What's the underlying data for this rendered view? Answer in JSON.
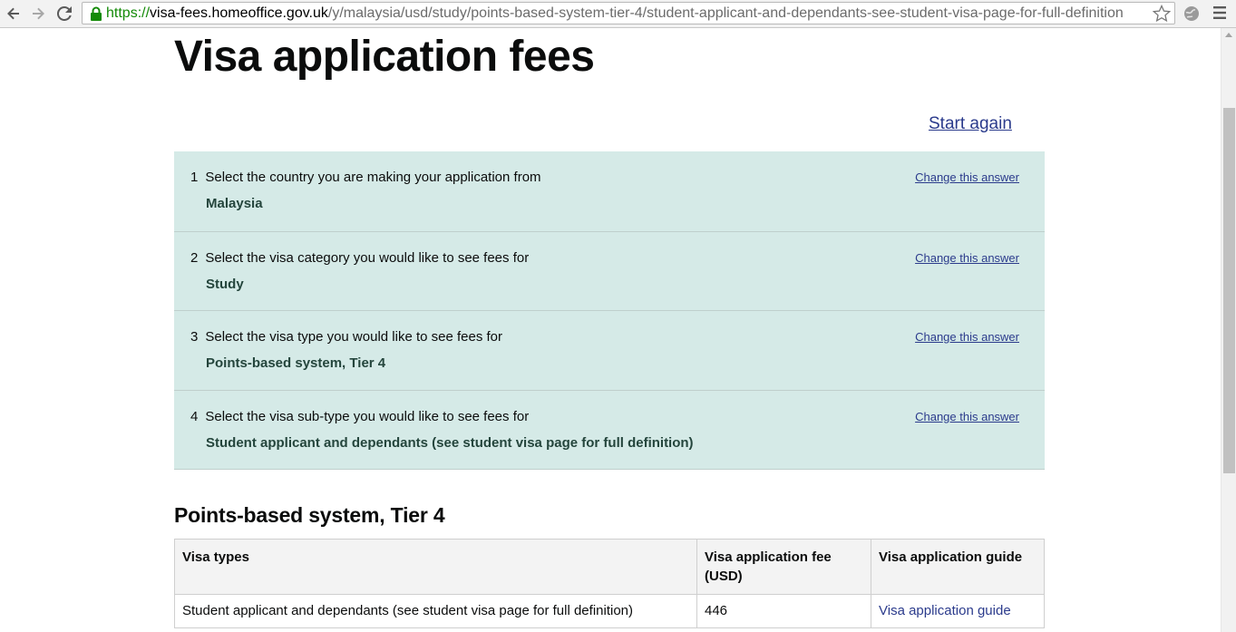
{
  "browser": {
    "url_scheme": "https://",
    "url_host": "visa-fees.homeoffice.gov.uk",
    "url_path": "/y/malaysia/usd/study/points-based-system-tier-4/student-applicant-and-dependants-see-student-visa-page-for-full-definition",
    "icons": [
      "back-icon",
      "forward-icon",
      "reload-icon",
      "lock-icon",
      "star-icon",
      "extension-icon",
      "menu-icon"
    ]
  },
  "page": {
    "title": "Visa application fees",
    "start_again": "Start again"
  },
  "answers": [
    {
      "number": "1",
      "question": "Select the country you are making your application from",
      "answer": "Malaysia",
      "change_label": "Change this answer"
    },
    {
      "number": "2",
      "question": "Select the visa category you would like to see fees for",
      "answer": "Study",
      "change_label": "Change this answer"
    },
    {
      "number": "3",
      "question": "Select the visa type you would like to see fees for",
      "answer": "Points-based system, Tier 4",
      "change_label": "Change this answer"
    },
    {
      "number": "4",
      "question": "Select the visa sub-type you would like to see fees for",
      "answer": "Student applicant and dependants (see student visa page for full definition)",
      "change_label": "Change this answer"
    }
  ],
  "results": {
    "heading": "Points-based system, Tier 4",
    "columns": [
      "Visa types",
      "Visa application fee (USD)",
      "Visa application guide"
    ],
    "rows": [
      {
        "visa_type": "Student applicant and dependants (see student visa page for full definition)",
        "fee": "446",
        "guide": "Visa application guide"
      }
    ]
  },
  "colors": {
    "answers_background": "#d5eae7",
    "link": "#2b3b8c",
    "answer_text": "#24453c",
    "secure_scheme": "#138a07"
  }
}
